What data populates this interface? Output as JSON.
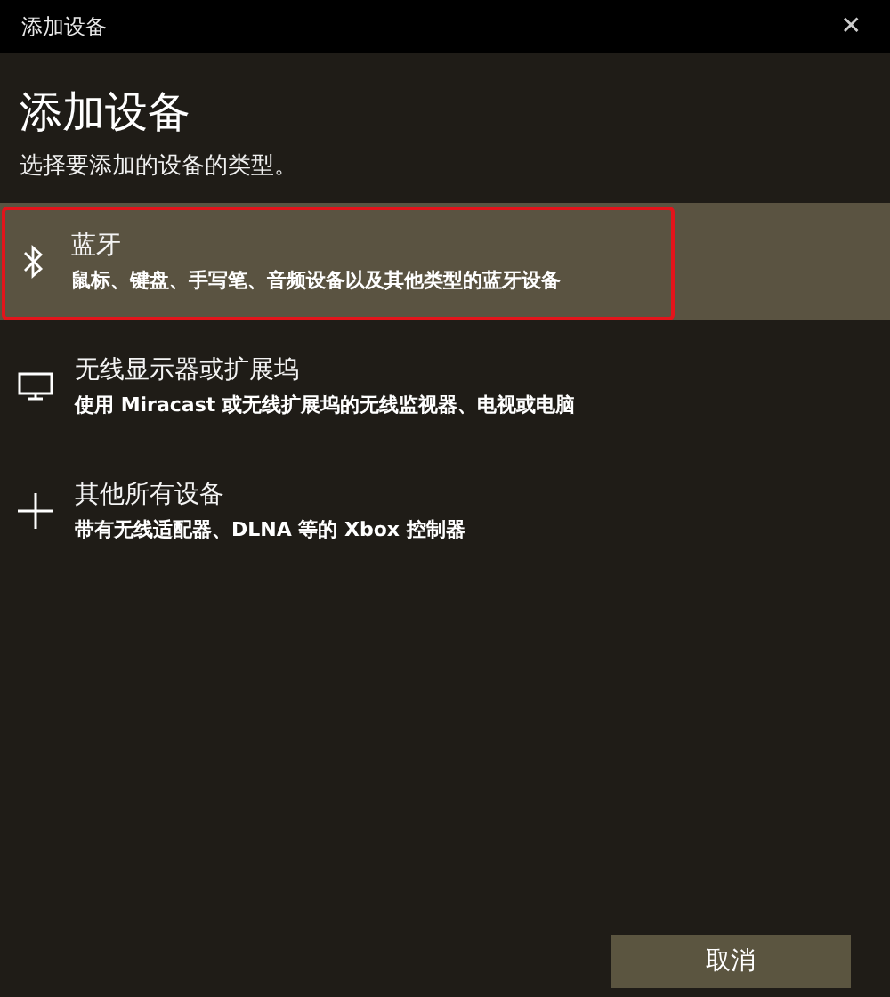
{
  "window": {
    "title": "添加设备",
    "close": "✕"
  },
  "heading": "添加设备",
  "subtitle": "选择要添加的设备的类型。",
  "options": [
    {
      "kind": "bluetooth",
      "title": "蓝牙",
      "description": "鼠标、键盘、手写笔、音频设备以及其他类型的蓝牙设备",
      "selected": true,
      "highlighted": true
    },
    {
      "kind": "display",
      "title": "无线显示器或扩展坞",
      "description": "使用 Miracast 或无线扩展坞的无线监视器、电视或电脑",
      "selected": false,
      "highlighted": false
    },
    {
      "kind": "other",
      "title": "其他所有设备",
      "description": "带有无线适配器、DLNA 等的 Xbox 控制器",
      "selected": false,
      "highlighted": false
    }
  ],
  "buttons": [
    "取消"
  ]
}
